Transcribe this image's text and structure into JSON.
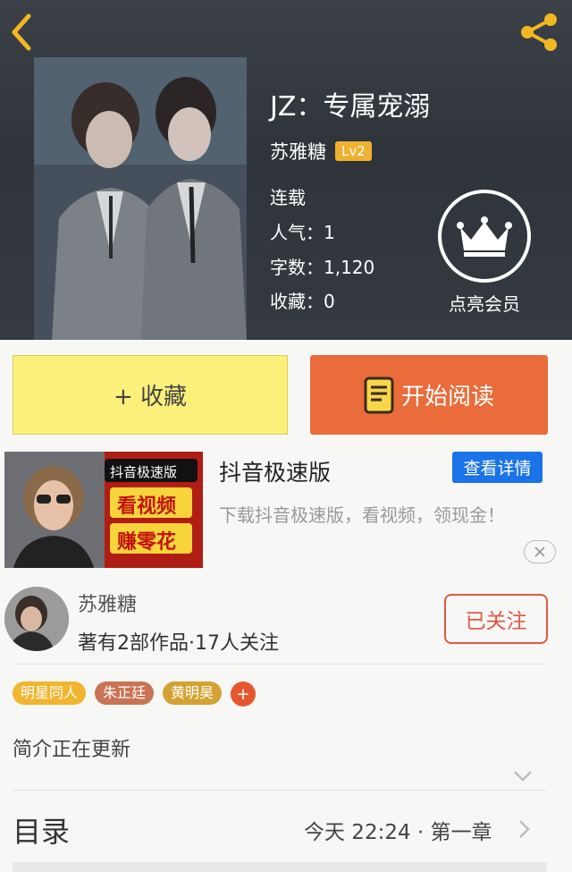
{
  "header": {
    "back_icon": "chevron-left-icon",
    "share_icon": "share-icon",
    "accent": "#f2b822"
  },
  "book": {
    "title": "JZ：专属宠溺",
    "author": "苏雅糖",
    "level": "Lv2",
    "status": "连载",
    "popularity": "人气：1",
    "word_count": "字数：1,120",
    "favorites": "收藏：0"
  },
  "vip": {
    "label": "点亮会员",
    "icon": "crown-icon"
  },
  "actions": {
    "collect": "+ 收藏",
    "read": "开始阅读",
    "read_icon": "book-icon",
    "collect_color": "#fbf07a",
    "read_color": "#ea6c3a"
  },
  "ad": {
    "title": "抖音极速版",
    "detail_button": "查看详情",
    "description": "下载抖音极速版，看视频，领现金！",
    "image_badge": "抖音极速版",
    "image_line1": "看视频",
    "image_line2": "赚零花",
    "close_icon": "close-icon"
  },
  "author_block": {
    "name": "苏雅糖",
    "stats": "著有2部作品·17人关注",
    "follow_button": "已关注"
  },
  "tags": [
    {
      "label": "明星同人",
      "color": "#f2b52f"
    },
    {
      "label": "朱正廷",
      "color": "#c97355"
    },
    {
      "label": "黄明昊",
      "color": "#d3a233"
    }
  ],
  "tag_add": "+",
  "intro": "简介正在更新",
  "toc": {
    "title": "目录",
    "latest": "今天 22:24 · 第一章"
  }
}
